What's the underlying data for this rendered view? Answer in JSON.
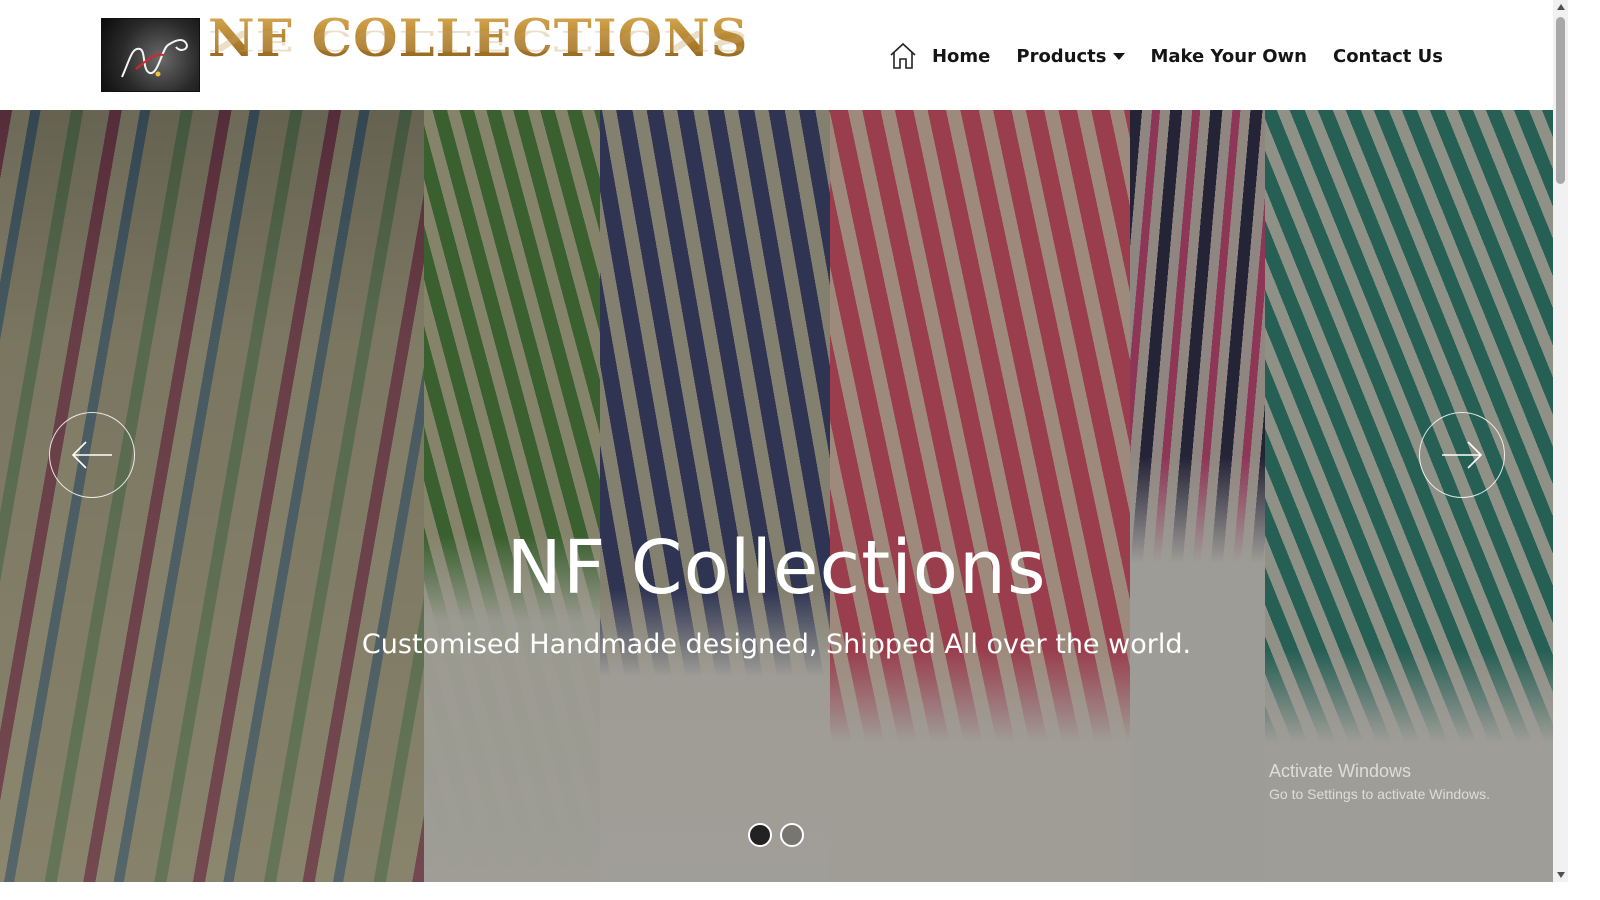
{
  "header": {
    "brand_text": "NF COLLECTIONS",
    "logo_icon": "nf-monogram-logo",
    "nav": {
      "home": "Home",
      "products": "Products",
      "make_your_own": "Make Your Own",
      "contact_us": "Contact Us"
    }
  },
  "hero": {
    "title": "NF Collections",
    "subtitle": "Customised Handmade designed, Shipped All over the world.",
    "prev_icon": "arrow-left-icon",
    "next_icon": "arrow-right-icon",
    "slides_total": 2,
    "active_slide": 1
  },
  "watermark": {
    "line1": "Activate Windows",
    "line2": "Go to Settings to activate Windows."
  },
  "colors": {
    "brand_gold": "#a8782a",
    "nav_text": "#151515",
    "caption_text": "#ffffff"
  }
}
